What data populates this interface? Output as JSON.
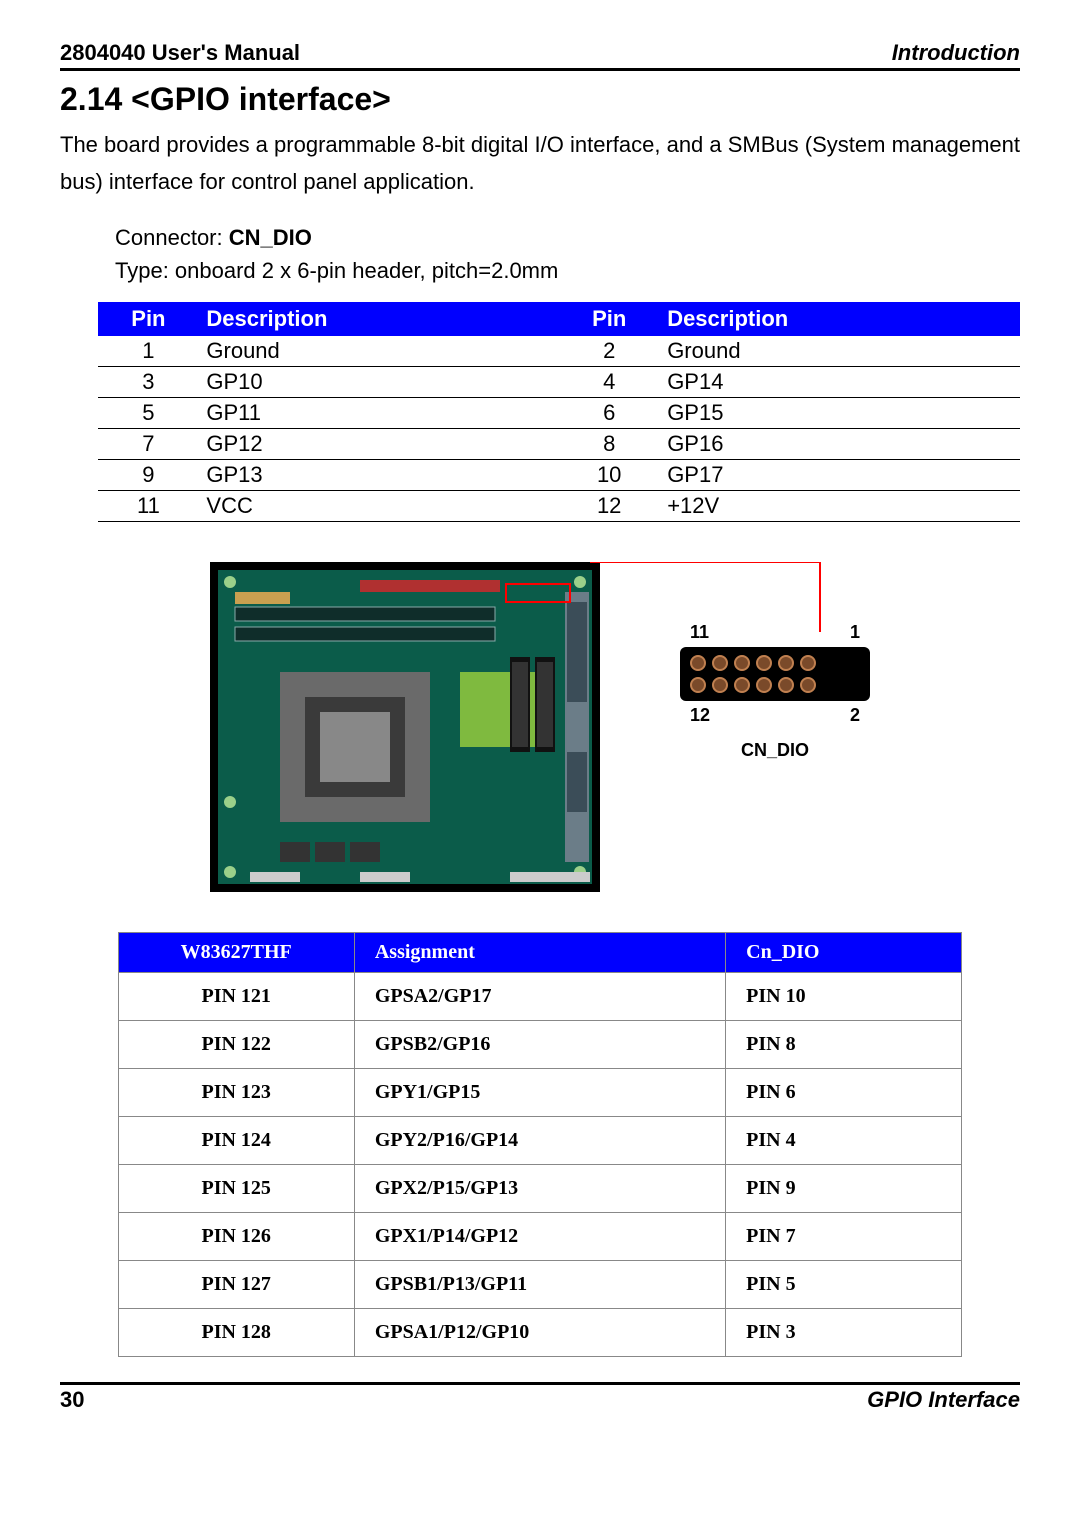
{
  "header": {
    "left": "2804040 User's Manual",
    "right": "Introduction"
  },
  "section_title": "2.14 <GPIO interface>",
  "intro": "The board provides a programmable 8-bit digital I/O interface, and a SMBus (System management bus) interface for control panel application.",
  "connector": {
    "label": "Connector: ",
    "name": "CN_DIO",
    "type": "Type: onboard 2 x 6-pin header, pitch=2.0mm"
  },
  "pin_table": {
    "headers": [
      "Pin",
      "Description",
      "Pin",
      "Description"
    ],
    "rows": [
      {
        "p1": "1",
        "d1": "Ground",
        "p2": "2",
        "d2": "Ground"
      },
      {
        "p1": "3",
        "d1": "GP10",
        "p2": "4",
        "d2": "GP14"
      },
      {
        "p1": "5",
        "d1": "GP11",
        "p2": "6",
        "d2": "GP15"
      },
      {
        "p1": "7",
        "d1": "GP12",
        "p2": "8",
        "d2": "GP16"
      },
      {
        "p1": "9",
        "d1": "GP13",
        "p2": "10",
        "d2": "GP17"
      },
      {
        "p1": "11",
        "d1": "VCC",
        "p2": "12",
        "d2": "+12V"
      }
    ]
  },
  "conn_fig": {
    "tl": "11",
    "tr": "1",
    "bl": "12",
    "br": "2",
    "name": "CN_DIO"
  },
  "assign_table": {
    "headers": [
      "W83627THF",
      "Assignment",
      "Cn_DIO"
    ],
    "rows": [
      {
        "c1": "PIN 121",
        "c2": "GPSA2/GP17",
        "c3": "PIN 10"
      },
      {
        "c1": "PIN 122",
        "c2": "GPSB2/GP16",
        "c3": "PIN 8"
      },
      {
        "c1": "PIN 123",
        "c2": "GPY1/GP15",
        "c3": "PIN 6"
      },
      {
        "c1": "PIN 124",
        "c2": "GPY2/P16/GP14",
        "c3": "PIN 4"
      },
      {
        "c1": "PIN 125",
        "c2": "GPX2/P15/GP13",
        "c3": "PIN 9"
      },
      {
        "c1": "PIN 126",
        "c2": "GPX1/P14/GP12",
        "c3": "PIN 7"
      },
      {
        "c1": "PIN 127",
        "c2": "GPSB1/P13/GP11",
        "c3": "PIN 5"
      },
      {
        "c1": "PIN 128",
        "c2": "GPSA1/P12/GP10",
        "c3": "PIN 3"
      }
    ]
  },
  "footer": {
    "left": "30",
    "right": "GPIO  Interface"
  }
}
